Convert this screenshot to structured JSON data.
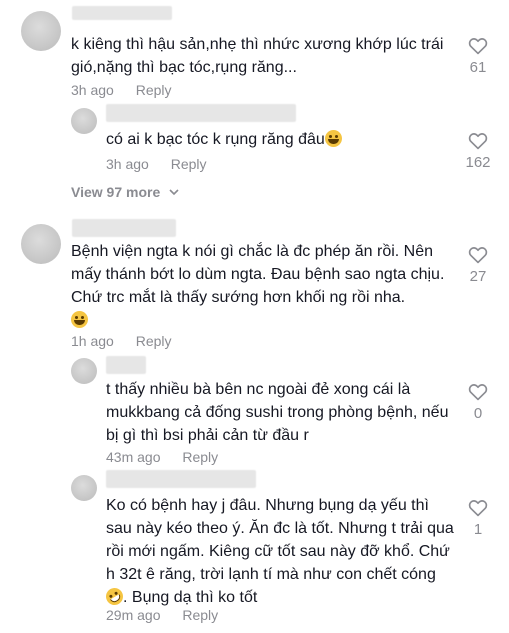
{
  "comments": [
    {
      "text": "k kiêng thì hậu sản,nhẹ thì nhức xương khớp lúc trái gió,nặng thì bạc tóc,rụng răng...",
      "time": "3h ago",
      "reply": "Reply",
      "likes": "61"
    },
    {
      "text": "có ai k bạc tóc k rụng răng đâu",
      "time": "3h ago",
      "reply": "Reply",
      "likes": "162"
    },
    {
      "text": "Bệnh viện ngta k nói gì chắc là đc phép ăn rồi. Nên mấy thánh bớt lo dùm ngta. Đau bệnh sao ngta chịu. Chứ trc mắt là thấy sướng hơn khối ng rồi nha.",
      "time": "1h ago",
      "reply": "Reply",
      "likes": "27"
    },
    {
      "text": "t thấy nhiều bà bên nc ngoài đẻ xong cái là mukkbang cả đống sushi trong phòng bệnh, nếu bị gì thì bsi phải cản từ đầu r",
      "time": "43m ago",
      "reply": "Reply",
      "likes": "0"
    },
    {
      "text": "Ko có bệnh hay j đâu. Nhưng bụng dạ yếu thì sau này kéo theo ý. Ăn đc là tốt. Nhưng t trải qua rồi mới ngấm. Kiêng cữ tốt sau này đỡ khổ. Chứ h 32t ê răng, trời lạnh tí mà như con chết cóng",
      "text_tail": ". Bụng dạ thì ko tốt",
      "time": "29m ago",
      "reply": "Reply",
      "likes": "1"
    }
  ],
  "view_more": "View 97 more",
  "icons": {
    "like": "heart-outline-icon",
    "chevron": "chevron-down-icon"
  }
}
